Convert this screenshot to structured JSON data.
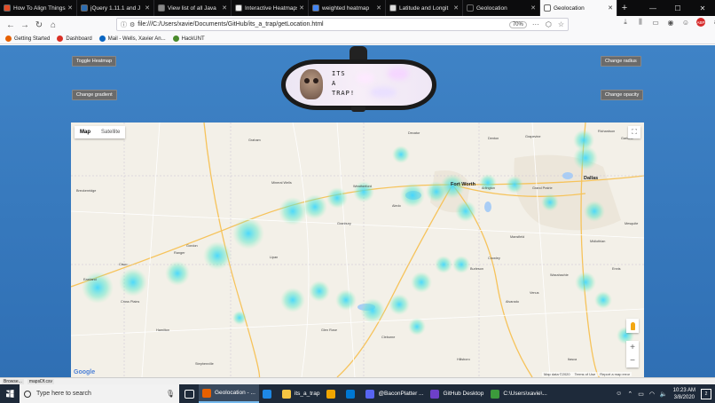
{
  "browser": {
    "tabs": [
      {
        "label": "How To Align Things",
        "color": "#e34c26",
        "active": false
      },
      {
        "label": "jQuery 1.11.1 and J",
        "color": "#2b6cb0",
        "active": false
      },
      {
        "label": "View list of all Java",
        "color": "#888888",
        "active": false
      },
      {
        "label": "Interactive Heatmaps w",
        "color": "#f0f0f0",
        "active": false
      },
      {
        "label": "weighted heatmap",
        "color": "#4285f4",
        "active": false
      },
      {
        "label": "Latitude and Longit",
        "color": "#dddddd",
        "active": false
      },
      {
        "label": "Geolocation",
        "color": "#0c0c0d",
        "active": false
      },
      {
        "label": "Geolocation",
        "color": "#ffffff",
        "active": true
      }
    ],
    "url": "file:///C:/Users/xavie/Documents/GitHub/its_a_trap/getLocation.html",
    "zoom": "70%",
    "bookmarks": [
      {
        "label": "Getting Started",
        "color": "#e66000"
      },
      {
        "label": "Dashboard",
        "color": "#d93025"
      },
      {
        "label": "Mail - Wells, Xavier An...",
        "color": "#0a66c2"
      },
      {
        "label": "HackUNT",
        "color": "#4a8b2c"
      }
    ]
  },
  "page": {
    "buttons": {
      "toggle_heatmap": "Toggle Heatmap",
      "change_gradient": "Change gradient",
      "change_radius": "Change radius",
      "change_opacity": "Change opacity"
    },
    "mirror_caption": [
      "ITS",
      "A",
      "TRAP!"
    ]
  },
  "map": {
    "type_map": "Map",
    "type_satellite": "Satellite",
    "google": "Google",
    "attribution": [
      "Map data ©2020",
      "Terms of Use",
      "Report a map error"
    ],
    "cities": [
      {
        "name": "Fort Worth",
        "big": true
      },
      {
        "name": "Dallas",
        "big": true
      },
      {
        "name": "Garland",
        "big": false
      },
      {
        "name": "Arlington",
        "big": false
      },
      {
        "name": "Grand Prairie",
        "big": false
      },
      {
        "name": "Grapevine",
        "big": false
      },
      {
        "name": "Richardson",
        "big": false
      },
      {
        "name": "Mesquite",
        "big": false
      },
      {
        "name": "Weatherford",
        "big": false
      },
      {
        "name": "Stephenville",
        "big": false
      },
      {
        "name": "Granbury",
        "big": false
      },
      {
        "name": "Cleburne",
        "big": false
      },
      {
        "name": "Burleson",
        "big": false
      },
      {
        "name": "Waxahachie",
        "big": false
      },
      {
        "name": "Mineral Wells",
        "big": false
      },
      {
        "name": "Glen Rose",
        "big": false
      },
      {
        "name": "Hillsboro",
        "big": false
      },
      {
        "name": "Breckenridge",
        "big": false
      },
      {
        "name": "Eastland",
        "big": false
      },
      {
        "name": "Cisco",
        "big": false
      },
      {
        "name": "Graham",
        "big": false
      },
      {
        "name": "Decatur",
        "big": false
      },
      {
        "name": "Denton",
        "big": false
      },
      {
        "name": "Ranger",
        "big": false
      },
      {
        "name": "Gordon",
        "big": false
      },
      {
        "name": "Aledo",
        "big": false
      },
      {
        "name": "Lipan",
        "big": false
      },
      {
        "name": "Cross Plains",
        "big": false
      },
      {
        "name": "Hamilton",
        "big": false
      },
      {
        "name": "Crowley",
        "big": false
      },
      {
        "name": "Mansfield",
        "big": false
      },
      {
        "name": "Midlothian",
        "big": false
      },
      {
        "name": "Venus",
        "big": false
      },
      {
        "name": "Alvarado",
        "big": false
      },
      {
        "name": "Ennis",
        "big": false
      },
      {
        "name": "Itasca",
        "big": false
      }
    ]
  },
  "downloads": [
    "Browse...",
    "mapsDf.csv"
  ],
  "taskbar": {
    "search_placeholder": "Type here to search",
    "items": [
      {
        "label": "Geolocation - ...",
        "color": "#e66000",
        "active": true
      },
      {
        "label": "",
        "color": "#1e88e5",
        "active": false
      },
      {
        "label": "its_a_trap",
        "color": "#f5c542",
        "active": false
      },
      {
        "label": "",
        "color": "#f0a500",
        "active": false
      },
      {
        "label": "",
        "color": "#0078d4",
        "active": false
      },
      {
        "label": "@BaconPlatter ...",
        "color": "#5865f2",
        "active": false
      },
      {
        "label": "GitHub Desktop",
        "color": "#6e40c9",
        "active": false
      },
      {
        "label": "C:\\Users\\xavie\\...",
        "color": "#3c9a3c",
        "active": false
      }
    ],
    "time": "10:23 AM",
    "date": "3/8/2020",
    "notifications": "2"
  }
}
